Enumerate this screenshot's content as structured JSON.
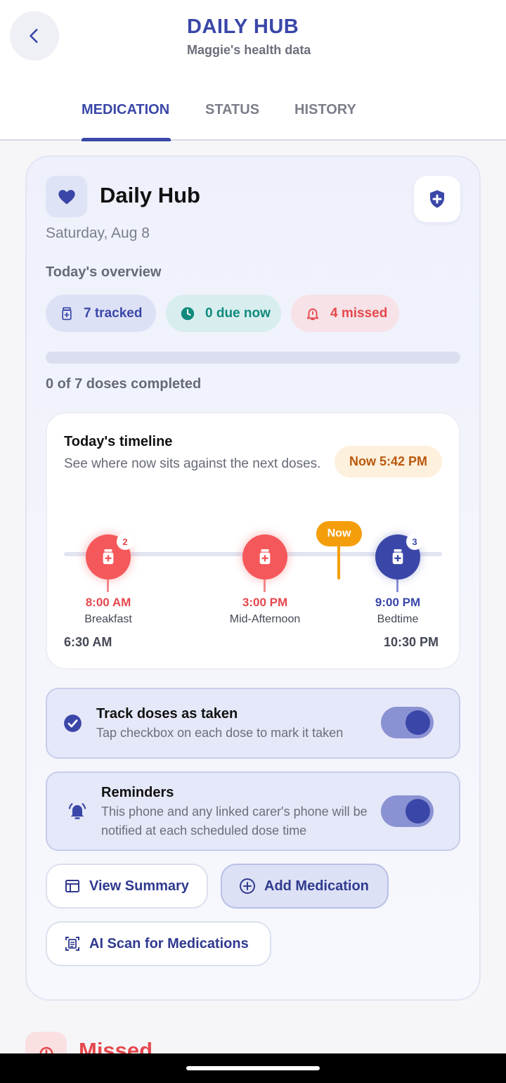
{
  "header": {
    "title": "DAILY HUB",
    "subtitle": "Maggie's health data",
    "back_icon": "chevron-left-icon"
  },
  "tabs": [
    {
      "label": "MEDICATION",
      "active": true
    },
    {
      "label": "STATUS",
      "active": false
    },
    {
      "label": "HISTORY",
      "active": false
    }
  ],
  "card": {
    "title": "Daily Hub",
    "date": "Saturday, Aug 8",
    "overview_label": "Today's overview",
    "chips": [
      {
        "label": "7 tracked",
        "icon": "pill-bottle-icon",
        "color": "#3a47a8"
      },
      {
        "label": "0 due now",
        "icon": "clock-icon",
        "color": "#0f8a7c"
      },
      {
        "label": "4 missed",
        "icon": "bell-alert-icon",
        "color": "#e5484d"
      }
    ],
    "progress": {
      "completed": 0,
      "total": 7,
      "fraction": 0.0,
      "text": "0 of 7 doses completed"
    }
  },
  "timeline": {
    "title": "Today's timeline",
    "description": "See where now sits against the next doses.",
    "now_pill": "Now 5:42 PM",
    "now_marker": "Now",
    "start": "6:30 AM",
    "end": "10:30 PM",
    "doses": [
      {
        "time": "8:00 AM",
        "label": "Breakfast",
        "count": "2",
        "status": "missed",
        "color": "#e5484d"
      },
      {
        "time": "3:00 PM",
        "label": "Mid-Afternoon",
        "count": "",
        "status": "missed",
        "color": "#e5484d"
      },
      {
        "time": "9:00 PM",
        "label": "Bedtime",
        "count": "3",
        "status": "upcoming",
        "color": "#3a47a8"
      }
    ]
  },
  "settings": {
    "track": {
      "title": "Track doses as taken",
      "description": "Tap checkbox on each dose to mark it taken",
      "enabled": true
    },
    "reminders": {
      "title": "Reminders",
      "description": "This phone and any linked carer's phone will be notified at each scheduled dose time",
      "enabled": true
    }
  },
  "actions": {
    "view_summary": "View Summary",
    "add_medication": "Add Medication",
    "ai_scan": "AI Scan for Medications"
  },
  "missed_section": {
    "heading": "Missed"
  },
  "colors": {
    "accent": "#3a47a8",
    "danger": "#e5484d",
    "teal": "#0f8a7c",
    "now": "#f59e0b"
  }
}
